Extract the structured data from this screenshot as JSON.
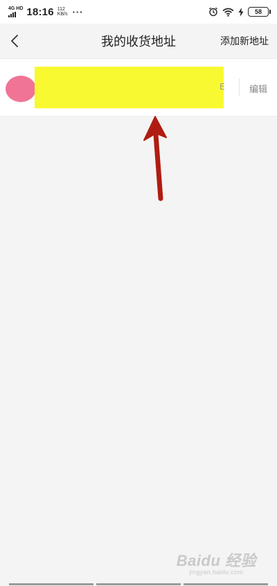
{
  "status_bar": {
    "network_type": "4G HD",
    "time": "18:16",
    "speed_value": "112",
    "speed_unit": "KB/s",
    "more": "···",
    "battery": "58"
  },
  "nav": {
    "title": "我的收货地址",
    "add_address": "添加新地址"
  },
  "address_list": {
    "items": [
      {
        "tail_text": "E",
        "edit_label": "编辑"
      }
    ]
  },
  "colors": {
    "radio": "#f07495",
    "redaction": "#f9f931",
    "arrow": "#b01c12"
  },
  "watermark": {
    "brand": "Baidu 经验",
    "url": "jingyan.baidu.com"
  }
}
